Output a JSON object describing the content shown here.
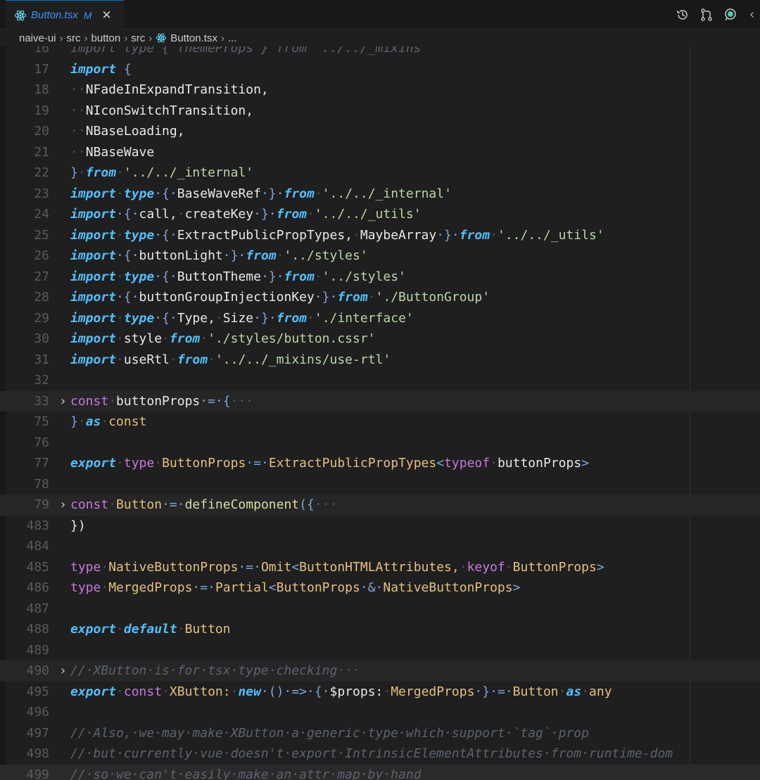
{
  "tab": {
    "title": "Button.tsx",
    "modified": "M",
    "close": "✕"
  },
  "breadcrumbs": [
    "naive-ui",
    "src",
    "button",
    "src",
    "Button.tsx",
    "..."
  ],
  "lines": [
    {
      "n": "16",
      "tokens": [
        [
          "import type { ThemeProps } from '../../_mixins'",
          "c"
        ]
      ]
    },
    {
      "n": "17",
      "tokens": [
        [
          "import",
          "k"
        ],
        [
          " {",
          "p"
        ]
      ]
    },
    {
      "n": "18",
      "tokens": [
        [
          "··",
          "dots"
        ],
        [
          "NFadeInExpandTransition,",
          "pl"
        ]
      ]
    },
    {
      "n": "19",
      "tokens": [
        [
          "··",
          "dots"
        ],
        [
          "NIconSwitchTransition,",
          "pl"
        ]
      ]
    },
    {
      "n": "20",
      "tokens": [
        [
          "··",
          "dots"
        ],
        [
          "NBaseLoading,",
          "pl"
        ]
      ]
    },
    {
      "n": "21",
      "tokens": [
        [
          "··",
          "dots"
        ],
        [
          "NBaseWave",
          "pl"
        ]
      ]
    },
    {
      "n": "22",
      "tokens": [
        [
          "}",
          "p"
        ],
        [
          "·",
          "dots"
        ],
        [
          "from",
          "k"
        ],
        [
          "·",
          "dots"
        ],
        [
          "'../../_internal'",
          "s"
        ]
      ]
    },
    {
      "n": "23",
      "tokens": [
        [
          "import",
          "k"
        ],
        [
          "·",
          "dots"
        ],
        [
          "type",
          "k"
        ],
        [
          "·{·",
          "p"
        ],
        [
          "BaseWaveRef",
          "pl"
        ],
        [
          "·}·",
          "p"
        ],
        [
          "from",
          "k"
        ],
        [
          "·",
          "dots"
        ],
        [
          "'../../_internal'",
          "s"
        ]
      ]
    },
    {
      "n": "24",
      "tokens": [
        [
          "import",
          "k"
        ],
        [
          "·{·",
          "p"
        ],
        [
          "call,",
          "pl"
        ],
        [
          "·",
          "dots"
        ],
        [
          "createKey",
          "pl"
        ],
        [
          "·}·",
          "p"
        ],
        [
          "from",
          "k"
        ],
        [
          "·",
          "dots"
        ],
        [
          "'../../_utils'",
          "s"
        ]
      ]
    },
    {
      "n": "25",
      "tokens": [
        [
          "import",
          "k"
        ],
        [
          "·",
          "dots"
        ],
        [
          "type",
          "k"
        ],
        [
          "·{·",
          "p"
        ],
        [
          "ExtractPublicPropTypes,",
          "pl"
        ],
        [
          "·",
          "dots"
        ],
        [
          "MaybeArray",
          "pl"
        ],
        [
          "·}·",
          "p"
        ],
        [
          "from",
          "k"
        ],
        [
          "·",
          "dots"
        ],
        [
          "'../../_utils'",
          "s"
        ]
      ]
    },
    {
      "n": "26",
      "tokens": [
        [
          "import",
          "k"
        ],
        [
          "·{·",
          "p"
        ],
        [
          "buttonLight",
          "pl"
        ],
        [
          "·}·",
          "p"
        ],
        [
          "from",
          "k"
        ],
        [
          "·",
          "dots"
        ],
        [
          "'../styles'",
          "s"
        ]
      ]
    },
    {
      "n": "27",
      "tokens": [
        [
          "import",
          "k"
        ],
        [
          "·",
          "dots"
        ],
        [
          "type",
          "k"
        ],
        [
          "·{·",
          "p"
        ],
        [
          "ButtonTheme",
          "pl"
        ],
        [
          "·}·",
          "p"
        ],
        [
          "from",
          "k"
        ],
        [
          "·",
          "dots"
        ],
        [
          "'../styles'",
          "s"
        ]
      ]
    },
    {
      "n": "28",
      "tokens": [
        [
          "import",
          "k"
        ],
        [
          "·{·",
          "p"
        ],
        [
          "buttonGroupInjectionKey",
          "pl"
        ],
        [
          "·}·",
          "p"
        ],
        [
          "from",
          "k"
        ],
        [
          "·",
          "dots"
        ],
        [
          "'./ButtonGroup'",
          "s"
        ]
      ]
    },
    {
      "n": "29",
      "tokens": [
        [
          "import",
          "k"
        ],
        [
          "·",
          "dots"
        ],
        [
          "type",
          "k"
        ],
        [
          "·{·",
          "p"
        ],
        [
          "Type,",
          "pl"
        ],
        [
          "·",
          "dots"
        ],
        [
          "Size",
          "pl"
        ],
        [
          "·}·",
          "p"
        ],
        [
          "from",
          "k"
        ],
        [
          "·",
          "dots"
        ],
        [
          "'./interface'",
          "s"
        ]
      ]
    },
    {
      "n": "30",
      "tokens": [
        [
          "import",
          "k"
        ],
        [
          "·",
          "dots"
        ],
        [
          "style",
          "pl"
        ],
        [
          "·",
          "dots"
        ],
        [
          "from",
          "k"
        ],
        [
          "·",
          "dots"
        ],
        [
          "'./styles/button.cssr'",
          "s"
        ]
      ]
    },
    {
      "n": "31",
      "tokens": [
        [
          "import",
          "k"
        ],
        [
          "·",
          "dots"
        ],
        [
          "useRtl",
          "pl"
        ],
        [
          "·",
          "dots"
        ],
        [
          "from",
          "k"
        ],
        [
          "·",
          "dots"
        ],
        [
          "'../../_mixins/use-rtl'",
          "s"
        ]
      ]
    },
    {
      "n": "32",
      "tokens": []
    },
    {
      "n": "33",
      "fold": true,
      "tokens": [
        [
          "const",
          "pur"
        ],
        [
          "·",
          "dots"
        ],
        [
          "buttonProps",
          "pl"
        ],
        [
          "·=·{",
          "p"
        ],
        [
          "···",
          "dots"
        ]
      ]
    },
    {
      "n": "75",
      "tokens": [
        [
          "}",
          "p"
        ],
        [
          "·",
          "dots"
        ],
        [
          "as",
          "k"
        ],
        [
          "·",
          "dots"
        ],
        [
          "const",
          "cw"
        ]
      ]
    },
    {
      "n": "76",
      "tokens": []
    },
    {
      "n": "77",
      "tokens": [
        [
          "export",
          "k"
        ],
        [
          "·",
          "dots"
        ],
        [
          "type",
          "pur"
        ],
        [
          "·",
          "dots"
        ],
        [
          "ButtonProps",
          "cw"
        ],
        [
          "·=·",
          "p"
        ],
        [
          "ExtractPublicPropTypes",
          "cw"
        ],
        [
          "<",
          "p"
        ],
        [
          "typeof",
          "pur"
        ],
        [
          "·",
          "dots"
        ],
        [
          "buttonProps",
          "pl"
        ],
        [
          ">",
          "p"
        ]
      ]
    },
    {
      "n": "78",
      "tokens": []
    },
    {
      "n": "79",
      "fold": true,
      "tokens": [
        [
          "const",
          "pur"
        ],
        [
          "·",
          "dots"
        ],
        [
          "Button",
          "cw"
        ],
        [
          "·=·",
          "p"
        ],
        [
          "defineComponent",
          "fn"
        ],
        [
          "({",
          "p"
        ],
        [
          "···",
          "dots"
        ]
      ]
    },
    {
      "n": "483",
      "tokens": [
        [
          "})",
          "pl"
        ]
      ]
    },
    {
      "n": "484",
      "tokens": []
    },
    {
      "n": "485",
      "tokens": [
        [
          "type",
          "pur"
        ],
        [
          "·",
          "dots"
        ],
        [
          "NativeButtonProps",
          "cw"
        ],
        [
          "·=·",
          "p"
        ],
        [
          "Omit",
          "cw"
        ],
        [
          "<",
          "p"
        ],
        [
          "ButtonHTMLAttributes,",
          "cw"
        ],
        [
          "·",
          "dots"
        ],
        [
          "keyof",
          "pur"
        ],
        [
          "·",
          "dots"
        ],
        [
          "ButtonProps",
          "cw"
        ],
        [
          ">",
          "p"
        ]
      ]
    },
    {
      "n": "486",
      "tokens": [
        [
          "type",
          "pur"
        ],
        [
          "·",
          "dots"
        ],
        [
          "MergedProps",
          "cw"
        ],
        [
          "·=·",
          "p"
        ],
        [
          "Partial",
          "cw"
        ],
        [
          "<",
          "p"
        ],
        [
          "ButtonProps",
          "cw"
        ],
        [
          "·&·",
          "p"
        ],
        [
          "NativeButtonProps",
          "cw"
        ],
        [
          ">",
          "p"
        ]
      ]
    },
    {
      "n": "487",
      "tokens": []
    },
    {
      "n": "488",
      "tokens": [
        [
          "export",
          "k"
        ],
        [
          "·",
          "dots"
        ],
        [
          "default",
          "k"
        ],
        [
          "·",
          "dots"
        ],
        [
          "Button",
          "cw"
        ]
      ]
    },
    {
      "n": "489",
      "tokens": []
    },
    {
      "n": "490",
      "fold": true,
      "tokens": [
        [
          "//·XButton·is·for·tsx·type·checking",
          "c"
        ],
        [
          "···",
          "dots"
        ]
      ]
    },
    {
      "n": "495",
      "tokens": [
        [
          "export",
          "k"
        ],
        [
          "·",
          "dots"
        ],
        [
          "const",
          "pur"
        ],
        [
          "·",
          "dots"
        ],
        [
          "XButton:",
          "cw"
        ],
        [
          "·",
          "dots"
        ],
        [
          "new",
          "k"
        ],
        [
          "·()·=>·{·",
          "p"
        ],
        [
          "$props:",
          "pl"
        ],
        [
          "·",
          "dots"
        ],
        [
          "MergedProps",
          "cw"
        ],
        [
          "·}·=·",
          "p"
        ],
        [
          "Button",
          "cw"
        ],
        [
          "·",
          "dots"
        ],
        [
          "as",
          "k"
        ],
        [
          "·",
          "dots"
        ],
        [
          "any",
          "cw"
        ]
      ]
    },
    {
      "n": "496",
      "tokens": []
    },
    {
      "n": "497",
      "tokens": [
        [
          "//·Also,·we·may·make·XButton·a·generic·type·which·support·`tag`·prop",
          "c"
        ]
      ]
    },
    {
      "n": "498",
      "tokens": [
        [
          "//·but·currently·vue·doesn't·export·IntrinsicElementAttributes·from·runtime-dom",
          "c"
        ]
      ]
    },
    {
      "n": "499",
      "last": true,
      "tokens": [
        [
          "//·so·we·can't·easily·make·an·attr·map·by·hand",
          "c"
        ]
      ]
    }
  ],
  "icons": [
    "history-icon",
    "source-control-icon",
    "copilot-chat-icon",
    "more-actions-icon"
  ]
}
